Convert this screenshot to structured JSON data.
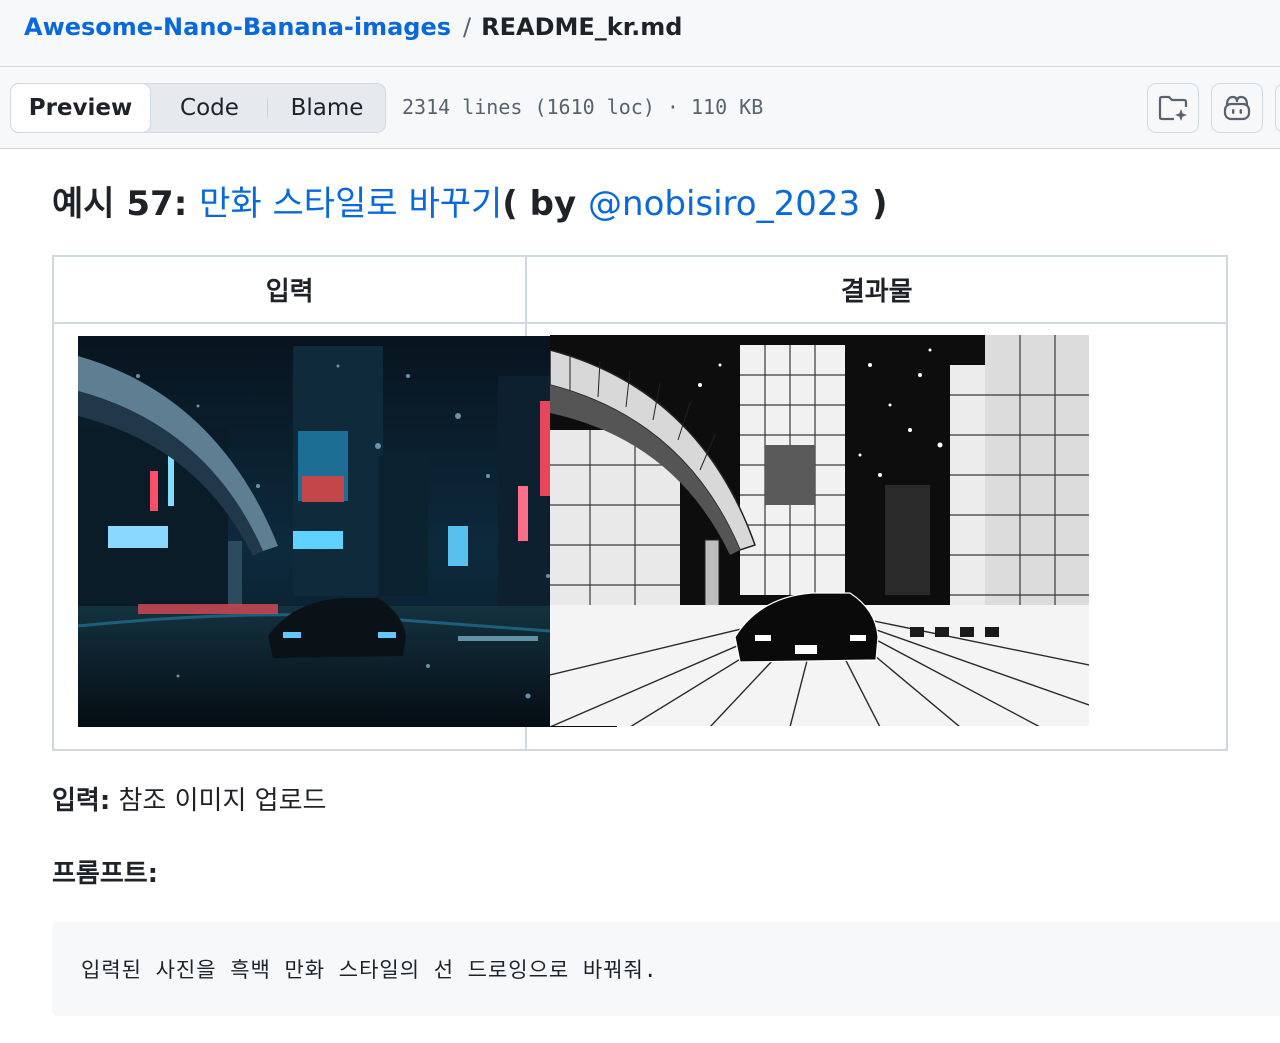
{
  "breadcrumb": {
    "repo": "Awesome-Nano-Banana-images",
    "separator": "/",
    "file": "README_kr.md"
  },
  "file_header": {
    "tabs": [
      {
        "label": "Preview",
        "active": true
      },
      {
        "label": "Code",
        "active": false
      },
      {
        "label": "Blame",
        "active": false
      }
    ],
    "info": "2314 lines (1610 loc) · 110 KB",
    "icons": [
      "folder-copilot-icon",
      "copilot-icon"
    ]
  },
  "content": {
    "heading": {
      "prefix": "예시 57: ",
      "title_link": "만화 스타일로 바꾸기",
      "paren_open": "( by ",
      "author_link": "@nobisiro_2023",
      "paren_close": " )"
    },
    "table": {
      "headers": [
        "입력",
        "결과물"
      ],
      "images": [
        {
          "name": "input-image",
          "style": "neon-night-tokyo-street-photo"
        },
        {
          "name": "output-image",
          "style": "black-and-white-manga-drawing"
        }
      ]
    },
    "input_line": {
      "label": "입력:",
      "text": " 참조 이미지 업로드"
    },
    "prompt_label": "프롬프트:",
    "prompt_code": "입력된 사진을 흑백 만화 스타일의 선 드로잉으로 바꿔줘."
  },
  "colors": {
    "link": "#0969da",
    "text": "#1f2328",
    "muted": "#59636e",
    "border": "#d1d9e0",
    "header_bg": "#f6f8fa"
  }
}
